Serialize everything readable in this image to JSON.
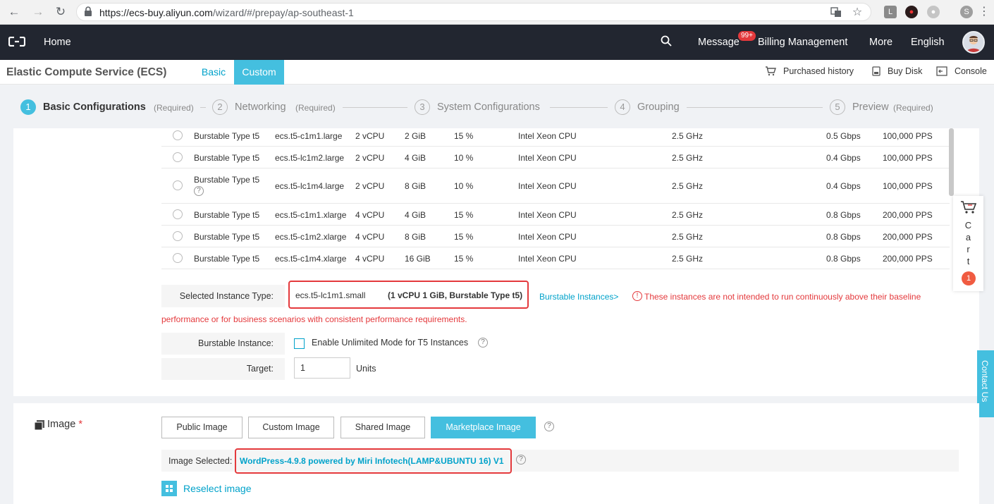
{
  "browser": {
    "url_domain": "https://ecs-buy.aliyun.com",
    "url_path": "/wizard/#/prepay/ap-southeast-1",
    "profile_letter": "S"
  },
  "topnav": {
    "home": "Home",
    "message": "Message",
    "message_badge": "99+",
    "billing": "Billing Management",
    "more": "More",
    "language": "English"
  },
  "subheader": {
    "title": "Elastic Compute Service (ECS)",
    "tab_basic": "Basic",
    "tab_custom": "Custom",
    "purchased_history": "Purchased history",
    "buy_disk": "Buy Disk",
    "console": "Console"
  },
  "steps": [
    {
      "num": "1",
      "label": "Basic Configurations",
      "req": "(Required)"
    },
    {
      "num": "2",
      "label": "Networking",
      "req": "(Required)"
    },
    {
      "num": "3",
      "label": "System Configurations",
      "req": ""
    },
    {
      "num": "4",
      "label": "Grouping",
      "req": ""
    },
    {
      "num": "5",
      "label": "Preview",
      "req": "(Required)"
    }
  ],
  "instances": [
    {
      "family": "Burstable Type t5",
      "type": "ecs.t5-c1m1.large",
      "vcpu": "2 vCPU",
      "mem": "2 GiB",
      "baseline": "15 %",
      "cpu": "Intel Xeon CPU",
      "freq": "2.5 GHz",
      "bw": "0.5 Gbps",
      "pps": "100,000 PPS"
    },
    {
      "family": "Burstable Type t5",
      "type": "ecs.t5-lc1m2.large",
      "vcpu": "2 vCPU",
      "mem": "4 GiB",
      "baseline": "10 %",
      "cpu": "Intel Xeon CPU",
      "freq": "2.5 GHz",
      "bw": "0.4 Gbps",
      "pps": "100,000 PPS"
    },
    {
      "family": "Burstable Type t5",
      "type": "ecs.t5-lc1m4.large",
      "vcpu": "2 vCPU",
      "mem": "8 GiB",
      "baseline": "10 %",
      "cpu": "Intel Xeon CPU",
      "freq": "2.5 GHz",
      "bw": "0.4 Gbps",
      "pps": "100,000 PPS"
    },
    {
      "family": "Burstable Type t5",
      "type": "ecs.t5-c1m1.xlarge",
      "vcpu": "4 vCPU",
      "mem": "4 GiB",
      "baseline": "15 %",
      "cpu": "Intel Xeon CPU",
      "freq": "2.5 GHz",
      "bw": "0.8 Gbps",
      "pps": "200,000 PPS"
    },
    {
      "family": "Burstable Type t5",
      "type": "ecs.t5-c1m2.xlarge",
      "vcpu": "4 vCPU",
      "mem": "8 GiB",
      "baseline": "15 %",
      "cpu": "Intel Xeon CPU",
      "freq": "2.5 GHz",
      "bw": "0.8 Gbps",
      "pps": "200,000 PPS"
    },
    {
      "family": "Burstable Type t5",
      "type": "ecs.t5-c1m4.xlarge",
      "vcpu": "4 vCPU",
      "mem": "16 GiB",
      "baseline": "15 %",
      "cpu": "Intel Xeon CPU",
      "freq": "2.5 GHz",
      "bw": "0.8 Gbps",
      "pps": "200,000 PPS"
    }
  ],
  "selected": {
    "label": "Selected Instance Type:",
    "type": "ecs.t5-lc1m1.small",
    "spec": "(1 vCPU 1 GiB, Burstable Type t5)",
    "link": "Burstable Instances>",
    "warning_line1": "These instances are not intended to run continuously above their baseline",
    "warning_line2": "performance or for business scenarios with consistent performance requirements."
  },
  "burstable": {
    "label": "Burstable Instance:",
    "checkbox_label": "Enable Unlimited Mode for T5 Instances"
  },
  "target": {
    "label": "Target:",
    "value": "1",
    "unit": "Units"
  },
  "cart": {
    "letters": [
      "C",
      "a",
      "r",
      "t"
    ],
    "count": "1"
  },
  "contact": "Contact Us",
  "image": {
    "title": "Image",
    "required_mark": "*",
    "buttons": [
      "Public Image",
      "Custom Image",
      "Shared Image",
      "Marketplace Image"
    ],
    "selected_label": "Image Selected:",
    "selected_value": "WordPress-4.9.8 powered by Miri Infotech(LAMP&UBUNTU 16) V1",
    "reselect": "Reselect image"
  },
  "colors": {
    "accent": "#44bfdf",
    "link": "#00a2ca",
    "error": "#e4393c",
    "nav_bg": "#222630"
  }
}
